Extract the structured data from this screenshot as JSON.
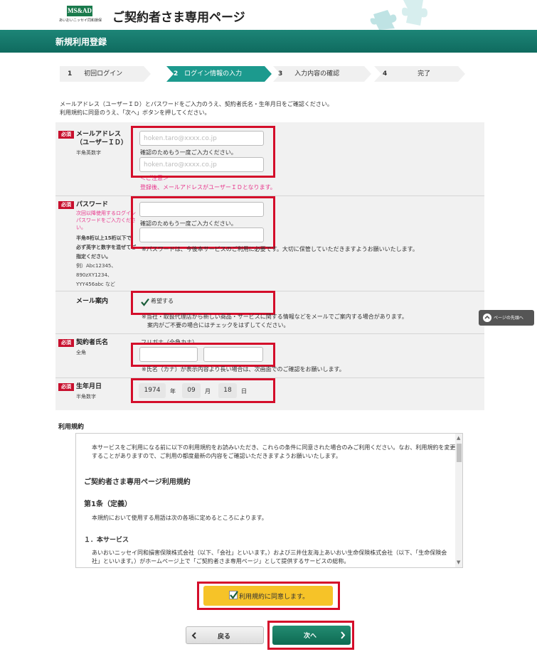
{
  "header": {
    "logo_text": "MS&AD",
    "logo_sub": "あいおいニッセイ同和損保",
    "site_title": "ご契約者さま専用ページ"
  },
  "banner": {
    "title": "新規利用登録"
  },
  "steps": [
    {
      "num": "1",
      "label": "初回ログイン"
    },
    {
      "num": "2",
      "label": "ログイン情報の入力"
    },
    {
      "num": "3",
      "label": "入力内容の確認"
    },
    {
      "num": "4",
      "label": "完了"
    }
  ],
  "intro": {
    "line1": "メールアドレス（ユーザーＩＤ）とパスワードをご入力のうえ、契約者氏名・生年月日をご確認ください。",
    "line2": "利用規約に同意のうえ、「次へ」ボタンを押してください。"
  },
  "required_badge": "必須",
  "email": {
    "label1": "メールアドレス",
    "label2": "（ユーザーＩＤ）",
    "sub": "半角英数字",
    "placeholder": "hoken.taro@xxxx.co.jp",
    "confirm_text": "確認のためもう一度ご入力ください。",
    "confirm_placeholder": "hoken.taro@xxxx.co.jp",
    "note_head": "＜ご注意＞",
    "note": "登録後、メールアドレスがユーザーＩＤとなります。"
  },
  "password": {
    "label": "パスワード",
    "sub_pink1": "次回以降使用するログイン",
    "sub_pink2": "パスワードをご入力くださ",
    "sub_pink3": "い。",
    "rule1": "半角8桁以上15桁以下で、",
    "rule2": "必ず英字と数字を混ぜてご",
    "rule3": "指定ください。",
    "ex1": "例）Abc12345、",
    "ex2": "890zXY1234、",
    "ex3": "YYY456abc など",
    "confirm_text": "確認のためもう一度ご入力ください。",
    "note": "※パスワードは、今後本サービスのご利用に必要です。大切に保管していただきますようお願いいたします。"
  },
  "mail_info": {
    "label": "メール案内",
    "checkbox_label": "希望する",
    "note1": "※当社・取扱代理店から新しい商品・サービスに関する情報などをメールでご案内する場合があります。",
    "note2": "案内がご不要の場合にはチェックをはずしてください。"
  },
  "name": {
    "label": "契約者氏名",
    "sub": "全角",
    "kana_label": "フリガナ（全角カナ）",
    "note": "※氏名（カナ）が表示内容より長い場合は、次画面でのご確認をお願いします。"
  },
  "birth": {
    "label": "生年月日",
    "sub": "半角数字",
    "year": "1974",
    "year_unit": "年",
    "month": "09",
    "month_unit": "月",
    "day": "18",
    "day_unit": "日"
  },
  "page_top": "ページの先頭へ",
  "terms": {
    "heading": "利用規約",
    "p1a": "本サービスをご利用になる前に以下の利用規約をお読みいただき、これらの条件に同意された場合のみご利用ください。なお、利用規約を変更",
    "p1b": "することがありますので、ご利用の都度最新の内容をご確認いただきますようお願いいたします。",
    "title": "ご契約者さま専用ページ利用規約",
    "art1": "第1条（定義）",
    "art1_text": "本規約において使用する用語は次の各項に定めるところによります。",
    "item1": "１．本サービス",
    "item1a": "あいおいニッセイ同和損害保険株式会社（以下、「会社」といいます。）および三井住友海上あいおい生命保険株式会社（以下、「生命保険会",
    "item1b": "社」といいます。）がホームページ上で「ご契約者さま専用ページ」として提供するサービスの総称。"
  },
  "agree_label": "利用規約に同意します。",
  "back_label": "戻る",
  "next_label": "次へ"
}
